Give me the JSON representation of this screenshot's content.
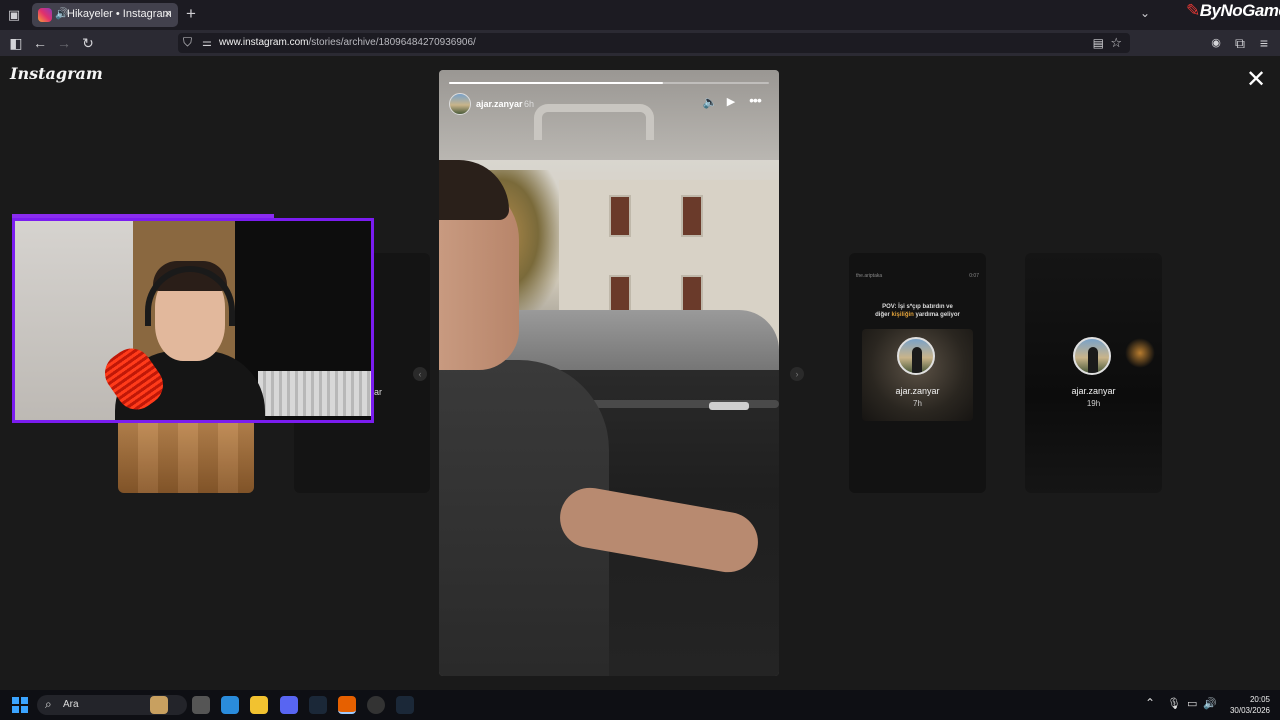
{
  "browser": {
    "tab_title": "Hikayeler • Instagram",
    "url_host": "www.instagram.com",
    "url_path": "/stories/archive/18096484270936906/",
    "brand_overlay": "ByNoGame"
  },
  "instagram": {
    "logo_text": "Instagram"
  },
  "story": {
    "username": "ajar.zanyar",
    "time": "6h",
    "progress": 0.67
  },
  "side_stories": {
    "left_2_label": "ar",
    "right_1": {
      "header_left": "the.ariptaka",
      "header_right": "0:07",
      "caption_a": "POV: İşi s*çıp batırdın ve",
      "caption_b": "diğer",
      "caption_highlight": "kişiliğin",
      "caption_c": "yardıma geliyor",
      "username": "ajar.zanyar",
      "time": "7h"
    },
    "right_2": {
      "username": "ajar.zanyar",
      "time": "19h"
    }
  },
  "taskbar": {
    "search_placeholder": "Ara",
    "time": "20:05",
    "date": "30/03/2026"
  },
  "colors": {
    "webcam_border": "#7b1cf0",
    "accent_highlight": "#e0a13a"
  },
  "icons": [
    "tabs-icon",
    "speaker-icon",
    "close-icon",
    "plus-icon",
    "chevron-down-icon",
    "sidebar-icon",
    "back-icon",
    "forward-icon",
    "reload-icon",
    "shield-icon",
    "permissions-icon",
    "reader-icon",
    "star-icon",
    "account-icon",
    "extensions-icon",
    "menu-icon",
    "volume-icon",
    "play-icon",
    "more-icon",
    "windows-icon",
    "search-icon"
  ]
}
